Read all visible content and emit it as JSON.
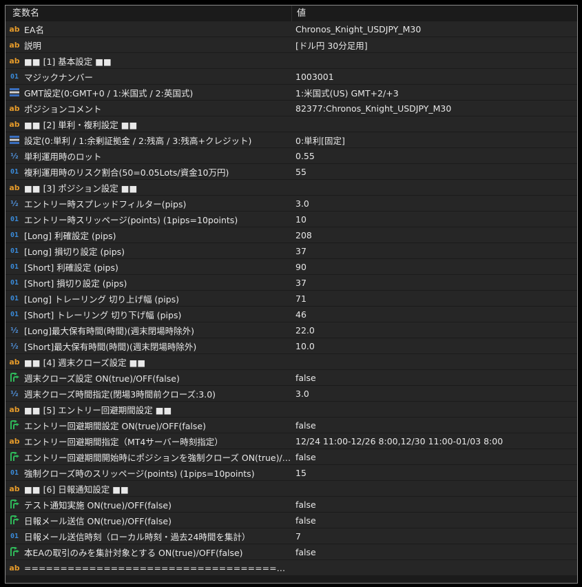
{
  "header": {
    "name_col": "変数名",
    "value_col": "値"
  },
  "colors": {
    "string_icon": "#e59a2a",
    "int_icon": "#3a8ad8",
    "enum_icon": "#4f8fd8",
    "bool_icon": "#2fb95a"
  },
  "rows": [
    {
      "type": "ab",
      "name": "EA名",
      "value": "Chronos_Knight_USDJPY_M30"
    },
    {
      "type": "ab",
      "name": "説明",
      "value": "[ドル円 30分足用]"
    },
    {
      "type": "ab",
      "name": "■■ [1] 基本設定 ■■",
      "value": ""
    },
    {
      "type": "int",
      "name": "マジックナンバー",
      "value": "1003001"
    },
    {
      "type": "enum",
      "name": "GMT設定(0:GMT+0 / 1:米国式 / 2:英国式)",
      "value": "1:米国式(US) GMT+2/+3"
    },
    {
      "type": "ab",
      "name": "ポジションコメント",
      "value": "82377:Chronos_Knight_USDJPY_M30"
    },
    {
      "type": "ab",
      "name": "■■ [2] 単利・複利設定 ■■",
      "value": ""
    },
    {
      "type": "enum",
      "name": "設定(0:単利 / 1:余剰証拠金 / 2:残高 / 3:残高+クレジット)",
      "value": "0:単利[固定]"
    },
    {
      "type": "dbl",
      "name": "単利運用時のロット",
      "value": "0.55"
    },
    {
      "type": "int",
      "name": "複利運用時のリスク割合(50=0.05Lots/資金10万円)",
      "value": "55"
    },
    {
      "type": "ab",
      "name": "■■ [3] ポジション設定 ■■",
      "value": ""
    },
    {
      "type": "dbl",
      "name": "エントリー時スプレッドフィルター(pips)",
      "value": "3.0"
    },
    {
      "type": "int",
      "name": "エントリー時スリッページ(points) (1pips=10points)",
      "value": "10"
    },
    {
      "type": "int",
      "name": "[Long] 利確設定 (pips)",
      "value": "208"
    },
    {
      "type": "int",
      "name": "[Long] 損切り設定 (pips)",
      "value": "37"
    },
    {
      "type": "int",
      "name": "[Short] 利確設定 (pips)",
      "value": "90"
    },
    {
      "type": "int",
      "name": "[Short] 損切り設定 (pips)",
      "value": "37"
    },
    {
      "type": "int",
      "name": "[Long] トレーリング 切り上げ幅 (pips)",
      "value": "71"
    },
    {
      "type": "int",
      "name": "[Short] トレーリング 切り下げ幅 (pips)",
      "value": "46"
    },
    {
      "type": "dbl",
      "name": "[Long]最大保有時間(時間)(週末閉場時除外)",
      "value": "22.0"
    },
    {
      "type": "dbl",
      "name": "[Short]最大保有時間(時間)(週末閉場時除外)",
      "value": "10.0"
    },
    {
      "type": "ab",
      "name": "■■ [4] 週末クローズ設定 ■■",
      "value": ""
    },
    {
      "type": "bool",
      "name": "週末クローズ設定 ON(true)/OFF(false)",
      "value": "false"
    },
    {
      "type": "dbl",
      "name": "週末クローズ時間指定(閉場3時間前クローズ:3.0)",
      "value": "3.0"
    },
    {
      "type": "ab",
      "name": "■■ [5] エントリー回避期間設定 ■■",
      "value": ""
    },
    {
      "type": "bool",
      "name": "エントリー回避期間設定 ON(true)/OFF(false)",
      "value": "false"
    },
    {
      "type": "ab",
      "name": "エントリー回避期間指定（MT4サーバー時刻指定）",
      "value": "12/24 11:00-12/26 8:00,12/30 11:00-01/03 8:00"
    },
    {
      "type": "bool",
      "name": "エントリー回避期間開始時にポジションを強制クローズ ON(true)/OFF...",
      "value": "false"
    },
    {
      "type": "int",
      "name": "強制クローズ時のスリッページ(points) (1pips=10points)",
      "value": "15"
    },
    {
      "type": "ab",
      "name": "■■ [6] 日報通知設定 ■■",
      "value": ""
    },
    {
      "type": "bool",
      "name": "テスト通知実施 ON(true)/OFF(false)",
      "value": "false"
    },
    {
      "type": "bool",
      "name": "日報メール送信 ON(true)/OFF(false)",
      "value": "false"
    },
    {
      "type": "int",
      "name": "日報メール送信時刻（ローカル時刻・過去24時間を集計）",
      "value": "7"
    },
    {
      "type": "bool",
      "name": "本EAの取引のみを集計対象とする ON(true)/OFF(false)",
      "value": "false"
    },
    {
      "type": "ab",
      "name": "==========================================...",
      "value": ""
    }
  ]
}
